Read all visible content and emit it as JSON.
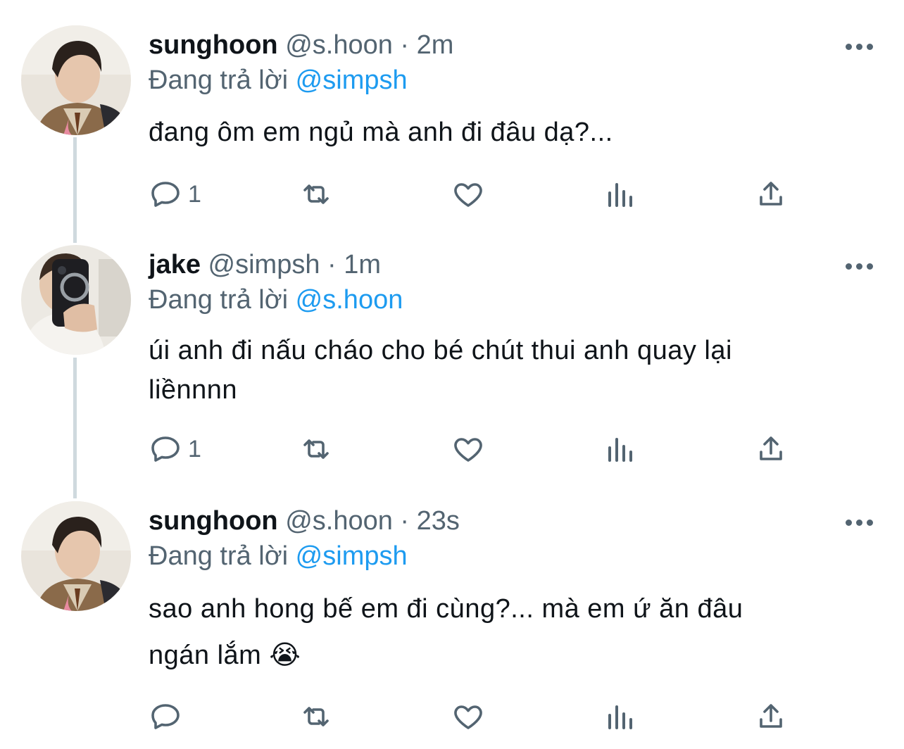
{
  "colors": {
    "text": "#0f1419",
    "secondary": "#536471",
    "mention": "#1d9bf0",
    "thread_line": "#cfd9de"
  },
  "tweets": [
    {
      "name": "sunghoon",
      "handle": "@s.hoon",
      "dot": "·",
      "time": "2m",
      "replying_prefix": "Đang trả lời",
      "replying_to": "@simpsh",
      "text_lines": [
        "đang ôm em ngủ mà anh đi đâu dạ?..."
      ],
      "reply_count": "1",
      "avatar_icon": "avatar-sunghoon"
    },
    {
      "name": "jake",
      "handle": "@simpsh",
      "dot": "·",
      "time": "1m",
      "replying_prefix": "Đang trả lời",
      "replying_to": "@s.hoon",
      "text_lines": [
        "úi anh đi nấu cháo cho bé chút thui anh quay lại",
        "liềnnnn"
      ],
      "reply_count": "1",
      "avatar_icon": "avatar-jake"
    },
    {
      "name": "sunghoon",
      "handle": "@s.hoon",
      "dot": "·",
      "time": "23s",
      "replying_prefix": "Đang trả lời",
      "replying_to": "@simpsh",
      "text_lines": [
        "sao anh hong bế em đi cùng?... mà em ứ ăn đâu",
        "ngán lắm 😭"
      ],
      "reply_count": "",
      "avatar_icon": "avatar-sunghoon"
    }
  ],
  "action_icons": [
    "reply-icon",
    "retweet-icon",
    "like-icon",
    "views-icon",
    "share-icon"
  ]
}
